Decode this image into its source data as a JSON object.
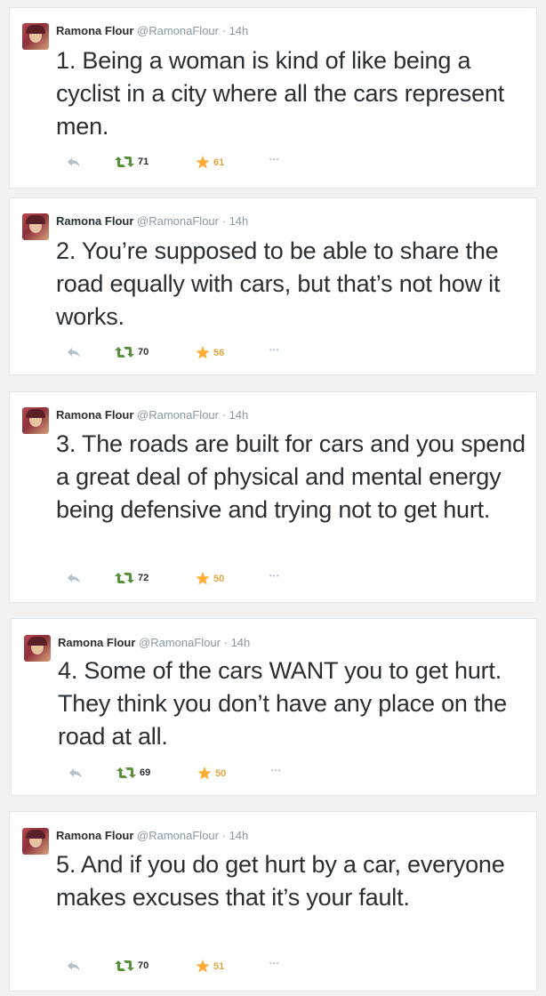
{
  "tweets": [
    {
      "author": "Ramona Flour",
      "handle": "@RamonaFlour",
      "separator": "·",
      "time": "14h",
      "text": "1. Being a woman is kind of like being a cyclist in a city where all the cars represent men.",
      "retweets": "71",
      "favorites": "61",
      "more_label": "•••"
    },
    {
      "author": "Ramona Flour",
      "handle": "@RamonaFlour",
      "separator": "·",
      "time": "14h",
      "text": "2. You’re supposed to be able to share the road equally with cars, but that’s not how it works.",
      "retweets": "70",
      "favorites": "56",
      "more_label": "•••"
    },
    {
      "author": "Ramona Flour",
      "handle": "@RamonaFlour",
      "separator": "·",
      "time": "14h",
      "text": "3. The roads are built for cars and you spend a great deal of physical and mental energy being defensive and trying not to get hurt.",
      "retweets": "72",
      "favorites": "50",
      "more_label": "•••"
    },
    {
      "author": "Ramona Flour",
      "handle": "@RamonaFlour",
      "separator": "·",
      "time": "14h",
      "text": "4. Some of the cars WANT you to get hurt. They think you don’t have any place on the road at all.",
      "retweets": "69",
      "favorites": "50",
      "more_label": "•••"
    },
    {
      "author": "Ramona Flour",
      "handle": "@RamonaFlour",
      "separator": "·",
      "time": "14h",
      "text": "5. And if you do get hurt by a car, everyone makes excuses that it’s your fault.",
      "retweets": "70",
      "favorites": "51",
      "more_label": "•••"
    }
  ],
  "colors": {
    "retweet": "#5c913b",
    "favorite": "#ffac33",
    "muted": "#8899a6"
  },
  "icons": [
    "reply-icon",
    "retweet-icon",
    "star-icon",
    "more-icon"
  ]
}
